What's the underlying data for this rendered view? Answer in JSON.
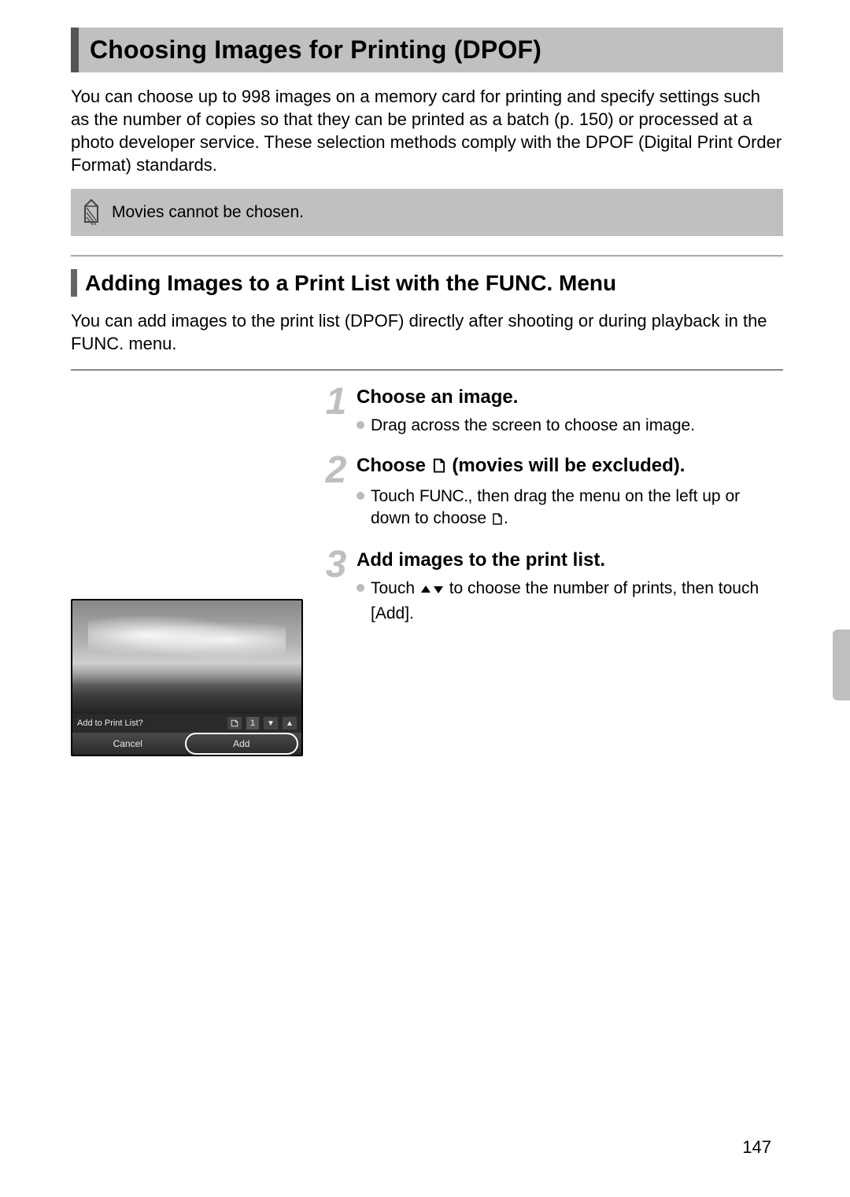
{
  "title": "Choosing Images for Printing (DPOF)",
  "intro": "You can choose up to 998 images on a memory card for printing and specify settings such as the number of copies so that they can be printed as a batch (p. 150) or processed at a photo developer service. These selection methods comply with the DPOF (Digital Print Order Format) standards.",
  "note": "Movies cannot be chosen.",
  "subhead": "Adding Images to a Print List with the FUNC. Menu",
  "subintro": "You can add images to the print list (DPOF) directly after shooting or during playback in the FUNC. menu.",
  "steps": [
    {
      "num": "1",
      "title": "Choose an image.",
      "bullets": [
        "Drag across the screen to choose an image."
      ]
    },
    {
      "num": "2",
      "title_pre": "Choose ",
      "title_post": " (movies will be excluded).",
      "bullets_pre": [
        "Touch "
      ],
      "func_label": "FUNC.",
      "bullets_mid": [
        ", then drag the menu on the left up or down to choose "
      ],
      "bullets_post": [
        "."
      ]
    },
    {
      "num": "3",
      "title": "Add images to the print list.",
      "bullets_pre": [
        "Touch "
      ],
      "bullets_post": [
        " to choose the number of prints, then touch [Add]."
      ]
    }
  ],
  "camera": {
    "prompt": "Add to Print List?",
    "count": "1",
    "cancel": "Cancel",
    "add": "Add"
  },
  "page": "147"
}
